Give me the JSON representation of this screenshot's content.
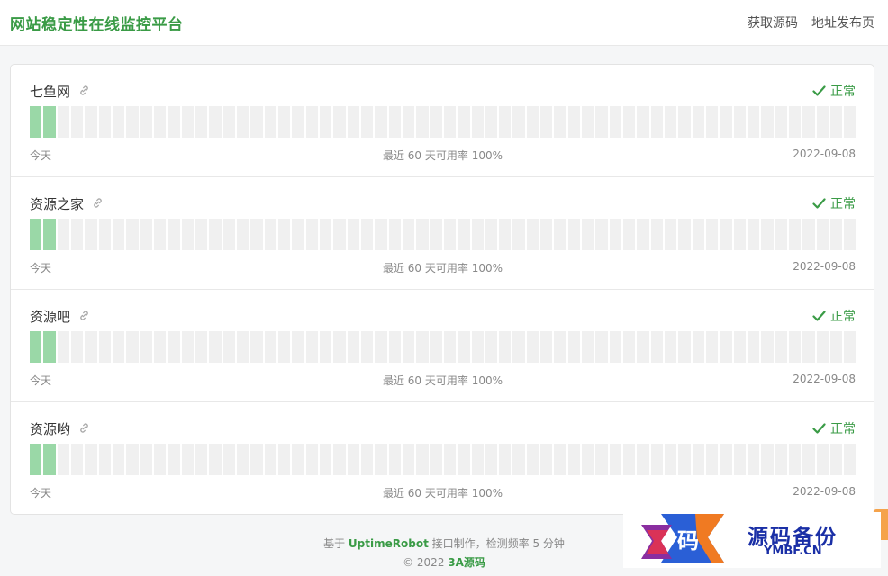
{
  "header": {
    "title": "网站稳定性在线监控平台",
    "nav": [
      "获取源码",
      "地址发布页"
    ]
  },
  "sites": [
    {
      "name": "七鱼网",
      "status": "正常",
      "ok_bars": 2,
      "total_bars": 60,
      "left_label": "今天",
      "center_label": "最近 60 天可用率 100%",
      "right_label": "2022-09-08"
    },
    {
      "name": "资源之家",
      "status": "正常",
      "ok_bars": 2,
      "total_bars": 60,
      "left_label": "今天",
      "center_label": "最近 60 天可用率 100%",
      "right_label": "2022-09-08"
    },
    {
      "name": "资源吧",
      "status": "正常",
      "ok_bars": 2,
      "total_bars": 60,
      "left_label": "今天",
      "center_label": "最近 60 天可用率 100%",
      "right_label": "2022-09-08"
    },
    {
      "name": "资源哟",
      "status": "正常",
      "ok_bars": 2,
      "total_bars": 60,
      "left_label": "今天",
      "center_label": "最近 60 天可用率 100%",
      "right_label": "2022-09-08"
    }
  ],
  "footer": {
    "line1_prefix": "基于 ",
    "line1_brand": "UptimeRobot",
    "line1_suffix": " 接口制作，检测频率 5 分钟",
    "line2_prefix": "© 2022 ",
    "line2_brand": "3A源码"
  },
  "watermark": {
    "logo_char": "码",
    "cn": "源码备份",
    "en": "YMBF.CN"
  },
  "colors": {
    "accent": "#3a9b46",
    "bar_ok": "#9ad8a7",
    "bar_empty": "#f0f0f0"
  }
}
